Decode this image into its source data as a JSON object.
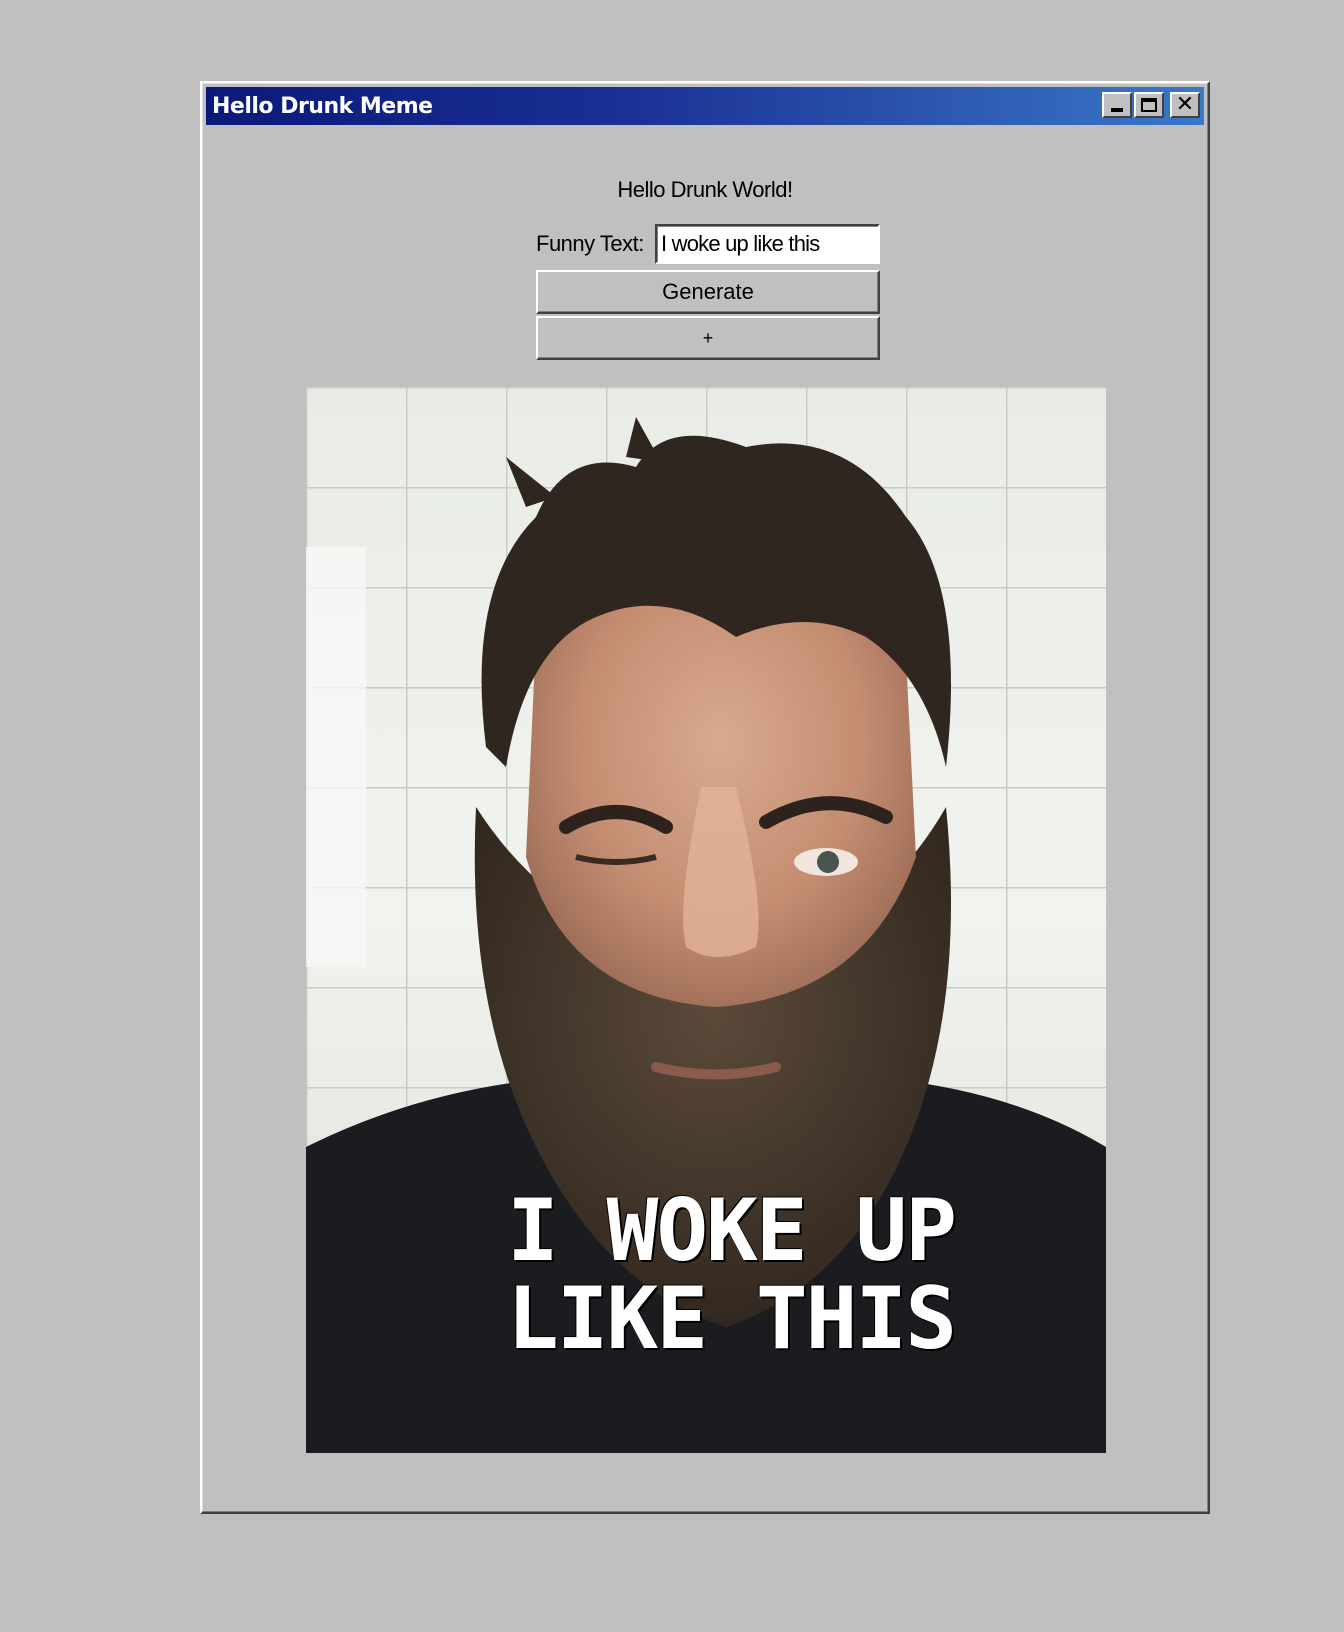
{
  "window": {
    "title": "Hello Drunk Meme",
    "controls": {
      "minimize": "minimize-icon",
      "maximize": "maximize-icon",
      "close": "close-icon"
    }
  },
  "main": {
    "greeting": "Hello Drunk World!",
    "funny_text_label": "Funny Text:",
    "funny_text_value": "I woke up like this",
    "generate_label": "Generate",
    "add_label": "+",
    "meme_caption": "I WOKE UP LIKE THIS"
  },
  "colors": {
    "title_bar_start": "#0a1a7a",
    "title_bar_end": "#3a78c8",
    "window_face": "#c0c0c0",
    "caption_text": "#ffffff"
  }
}
